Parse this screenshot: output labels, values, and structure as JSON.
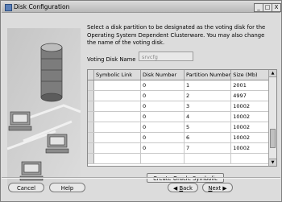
{
  "window": {
    "title": "Disk Configuration",
    "controls": {
      "minimize": "_",
      "maximize": "□",
      "close": "X"
    }
  },
  "instructions": "Select a disk partition to be designated as the voting disk for the Operating System Dependent Clusterware. You may also change the name of the voting disk.",
  "voting_disk": {
    "label": "Voting Disk Name",
    "value": "srvcfg"
  },
  "table": {
    "columns": [
      "Symbolic Link",
      "Disk Number",
      "Partition Number",
      "Size (Mb)"
    ],
    "rows": [
      {
        "link": "",
        "disk": "0",
        "partition": "1",
        "size": "2001"
      },
      {
        "link": "",
        "disk": "0",
        "partition": "2",
        "size": "4997"
      },
      {
        "link": "",
        "disk": "0",
        "partition": "3",
        "size": "10002"
      },
      {
        "link": "",
        "disk": "0",
        "partition": "4",
        "size": "10002"
      },
      {
        "link": "",
        "disk": "0",
        "partition": "5",
        "size": "10002"
      },
      {
        "link": "",
        "disk": "0",
        "partition": "6",
        "size": "10002"
      },
      {
        "link": "",
        "disk": "0",
        "partition": "7",
        "size": "10002"
      }
    ]
  },
  "buttons": {
    "create_links": "Create Oracle Symbolic Links",
    "cancel": "Cancel",
    "help": "Help",
    "back_arrow": "◀",
    "back_mnemonic": "B",
    "back_rest": "ack",
    "next_mnemonic": "N",
    "next_rest": "ext",
    "next_arrow": "▶"
  },
  "colors": {
    "window_bg": "#dcdcdc",
    "table_bg": "#ffffff",
    "title_icon": "#5a7fb8"
  }
}
